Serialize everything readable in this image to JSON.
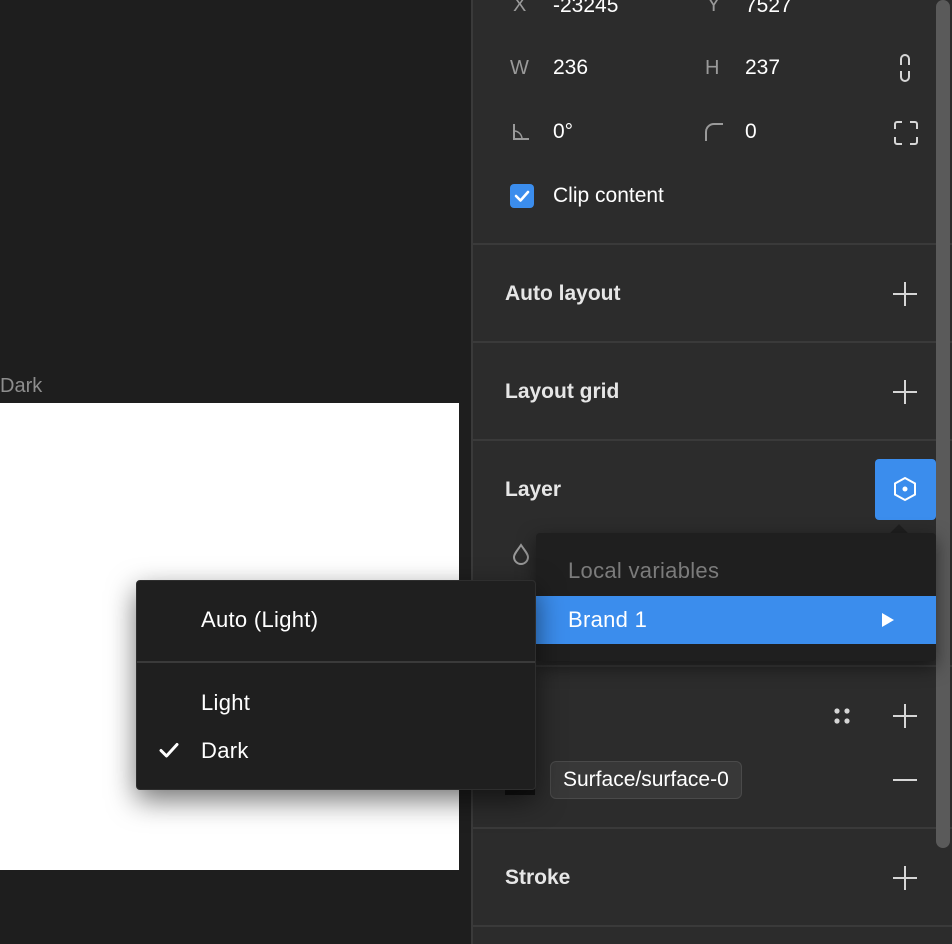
{
  "canvas": {
    "frame_label": "Dark"
  },
  "panel": {
    "x": {
      "label": "X",
      "value": "-23245"
    },
    "y": {
      "label": "Y",
      "value": "7527"
    },
    "w": {
      "label": "W",
      "value": "236"
    },
    "h": {
      "label": "H",
      "value": "237"
    },
    "rotation": {
      "value": "0°"
    },
    "radius": {
      "value": "0"
    },
    "clip_content": {
      "label": "Clip content",
      "checked": true
    },
    "sections": {
      "auto_layout": "Auto layout",
      "layout_grid": "Layout grid",
      "layer": "Layer",
      "stroke": "Stroke"
    },
    "fill": {
      "variable_chip": "Surface/surface-0",
      "swatch_color": "#111111"
    }
  },
  "variables_popover": {
    "header": "Local variables",
    "item": "Brand 1"
  },
  "mode_menu": {
    "items": [
      "Auto (Light)",
      "Light",
      "Dark"
    ],
    "selected": "Dark"
  },
  "colors": {
    "accent": "#3b8ded",
    "panel_bg": "#2c2c2c",
    "canvas_bg": "#1e1e1e",
    "menu_bg": "#1f1f1f"
  },
  "icons": {
    "constrain_proportions": "link-icon",
    "rotation": "angle-icon",
    "corner_radius": "corner-icon",
    "independent_corners": "expand-corners-icon",
    "add": "plus-icon",
    "remove": "minus-icon",
    "layer_variable": "hexagon-variable-icon",
    "opacity": "drop-icon",
    "styles": "four-dots-icon",
    "submenu": "caret-right-icon",
    "selected": "check-icon"
  }
}
